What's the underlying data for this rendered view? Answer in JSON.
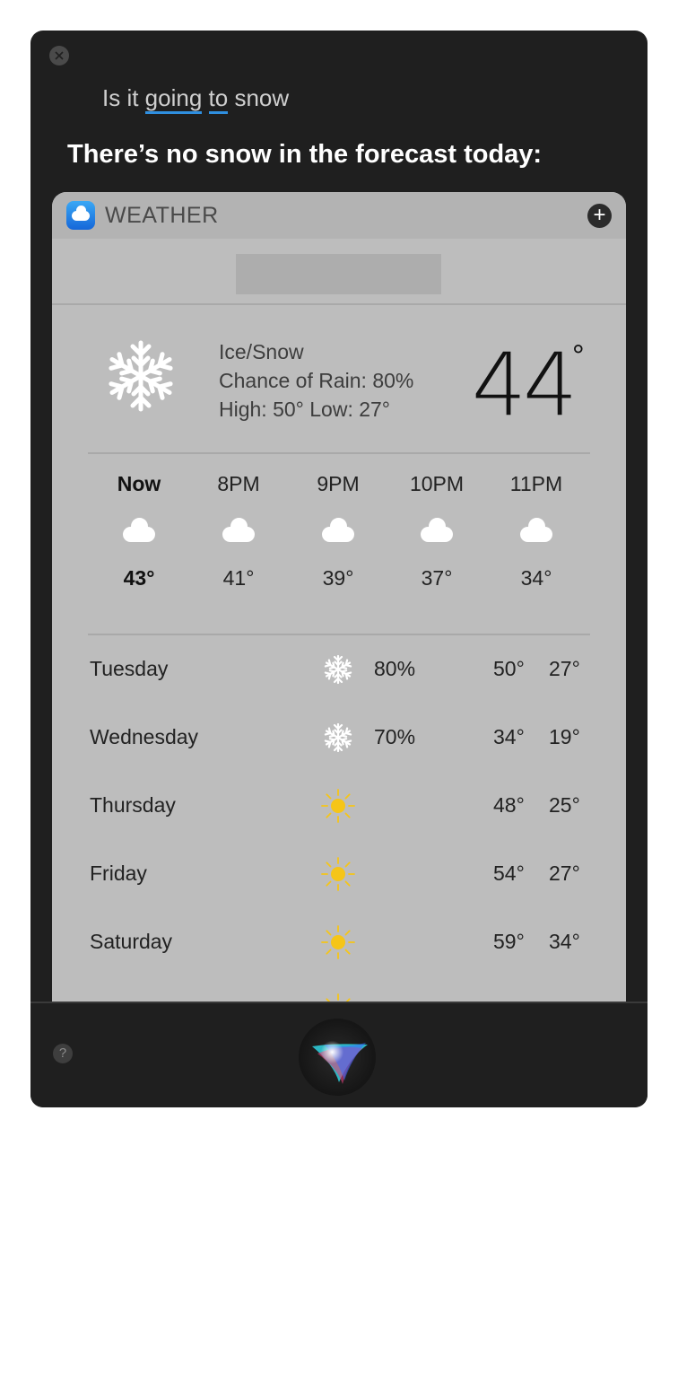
{
  "siri": {
    "query_parts": [
      "Is it ",
      "going",
      " ",
      "to",
      " snow"
    ],
    "answer": "There’s no snow in the forecast today:"
  },
  "card": {
    "app_name": "WEATHER",
    "add_label": "+",
    "location": ""
  },
  "current": {
    "condition": "Ice/Snow",
    "chance_of_rain": "Chance of Rain: 80%",
    "high_low": "High: 50° Low: 27°",
    "temperature": "44",
    "degree": "°",
    "icon": "snowflake-icon"
  },
  "hourly": [
    {
      "label": "Now",
      "temp": "43°",
      "icon": "cloud-icon",
      "bold": true
    },
    {
      "label": "8PM",
      "temp": "41°",
      "icon": "cloud-icon",
      "bold": false
    },
    {
      "label": "9PM",
      "temp": "39°",
      "icon": "cloud-icon",
      "bold": false
    },
    {
      "label": "10PM",
      "temp": "37°",
      "icon": "cloud-icon",
      "bold": false
    },
    {
      "label": "11PM",
      "temp": "34°",
      "icon": "cloud-icon",
      "bold": false
    }
  ],
  "daily": [
    {
      "day": "Tuesday",
      "icon": "snowflake-icon",
      "pct": "80%",
      "hi": "50°",
      "lo": "27°"
    },
    {
      "day": "Wednesday",
      "icon": "snowflake-icon",
      "pct": "70%",
      "hi": "34°",
      "lo": "19°"
    },
    {
      "day": "Thursday",
      "icon": "sun-icon",
      "pct": "",
      "hi": "48°",
      "lo": "25°"
    },
    {
      "day": "Friday",
      "icon": "sun-icon",
      "pct": "",
      "hi": "54°",
      "lo": "27°"
    },
    {
      "day": "Saturday",
      "icon": "sun-icon",
      "pct": "",
      "hi": "59°",
      "lo": "34°"
    }
  ],
  "footer": {
    "help_label": "?"
  },
  "colors": {
    "window_bg": "#1f1f1f",
    "card_bg": "#bdbdbd",
    "sun": "#f5c518",
    "link_underline": "#2f8fe0"
  }
}
